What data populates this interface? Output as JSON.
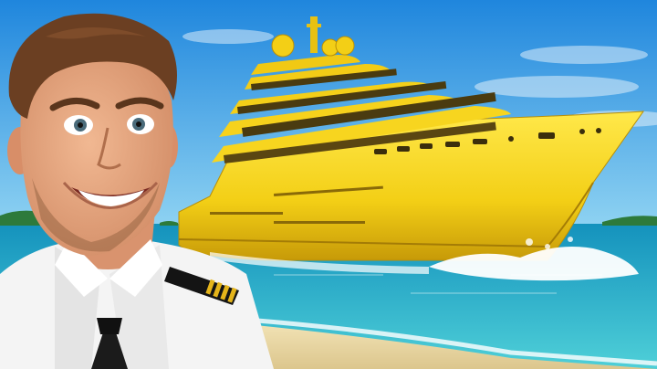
{
  "image": {
    "kind": "photo-thumbnail",
    "elements": [
      "sky-icon",
      "ocean-icon",
      "island-icon",
      "beach-icon",
      "golden-yacht-icon",
      "wake-splash-icon",
      "person-captain-icon",
      "epaulette-icon",
      "necktie-icon"
    ]
  },
  "colors": {
    "sky_top": "#1f86dd",
    "sky_bottom": "#8fd3f2",
    "ocean": "#1aa6c8",
    "ocean_shallow": "#4fd0d8",
    "sand": "#ead9a8",
    "gold": "#f3cf16",
    "gold_dark": "#b98f07",
    "skin": "#e8a983",
    "hair": "#6b3f22",
    "shirt": "#f4f4f4",
    "tie": "#1b1b1b"
  }
}
